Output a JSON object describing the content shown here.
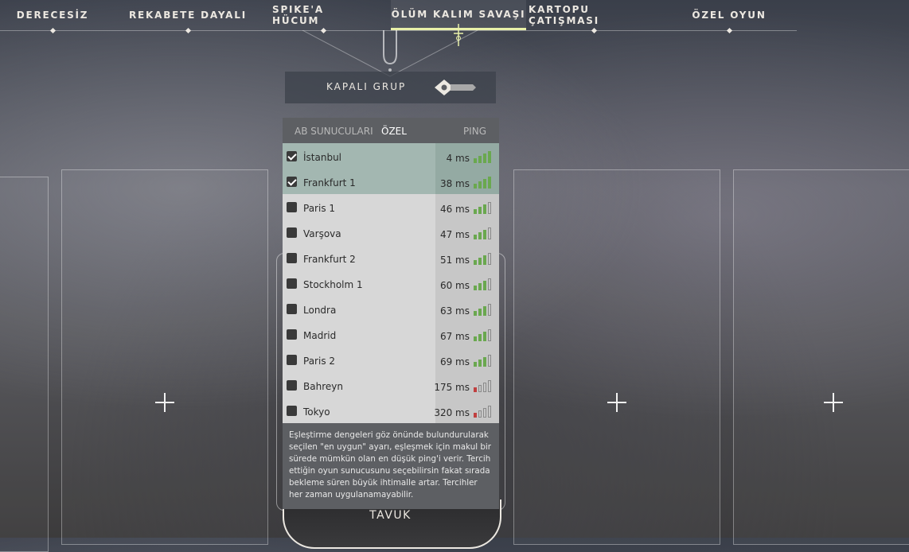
{
  "nav": {
    "tabs": [
      {
        "label": "DERECESİZ",
        "active": false
      },
      {
        "label": "REKABETE DAYALI",
        "active": false
      },
      {
        "label": "SPIKE'A HÜCUM",
        "active": false
      },
      {
        "label": "ÖLÜM KALIM SAVAŞI",
        "active": true
      },
      {
        "label": "KARTOPU ÇATIŞMASI",
        "active": false
      },
      {
        "label": "ÖZEL OYUN",
        "active": false
      }
    ]
  },
  "group": {
    "label": "KAPALI GRUP",
    "toggle_icon": "toggle-icon"
  },
  "servers": {
    "header_regional": "AB SUNUCULARI",
    "header_custom": "ÖZEL",
    "header_ping": "PING",
    "list": [
      {
        "name": "İstanbul",
        "ping": "4 ms",
        "checked": true,
        "signal": 4,
        "signal_color": "#6aa84f"
      },
      {
        "name": "Frankfurt 1",
        "ping": "38 ms",
        "checked": true,
        "signal": 4,
        "signal_color": "#6aa84f"
      },
      {
        "name": "Paris 1",
        "ping": "46 ms",
        "checked": false,
        "signal": 3,
        "signal_color": "#6aa84f"
      },
      {
        "name": "Varşova",
        "ping": "47 ms",
        "checked": false,
        "signal": 3,
        "signal_color": "#6aa84f"
      },
      {
        "name": "Frankfurt 2",
        "ping": "51 ms",
        "checked": false,
        "signal": 3,
        "signal_color": "#6aa84f"
      },
      {
        "name": "Stockholm 1",
        "ping": "60 ms",
        "checked": false,
        "signal": 3,
        "signal_color": "#6aa84f"
      },
      {
        "name": "Londra",
        "ping": "63 ms",
        "checked": false,
        "signal": 3,
        "signal_color": "#6aa84f"
      },
      {
        "name": "Madrid",
        "ping": "67 ms",
        "checked": false,
        "signal": 3,
        "signal_color": "#6aa84f"
      },
      {
        "name": "Paris 2",
        "ping": "69 ms",
        "checked": false,
        "signal": 3,
        "signal_color": "#6aa84f"
      },
      {
        "name": "Bahreyn",
        "ping": "175 ms",
        "checked": false,
        "signal": 1,
        "signal_color": "#c04040"
      },
      {
        "name": "Tokyo",
        "ping": "320 ms",
        "checked": false,
        "signal": 1,
        "signal_color": "#c04040"
      }
    ],
    "info_text": "Eşleştirme dengeleri göz önünde bulundurularak seçilen \"en uygun\" ayarı, eşleşmek için makul bir sürede mümkün olan en düşük ping'i verir. Tercih ettiğin oyun sunucusunu seçebilirsin fakat sırada bekleme süren büyük ihtimalle artar. Tercihler her zaman uygulanamayabilir."
  },
  "map": {
    "name": "TAVUK"
  },
  "slots": {
    "add_icon": "plus-icon"
  }
}
